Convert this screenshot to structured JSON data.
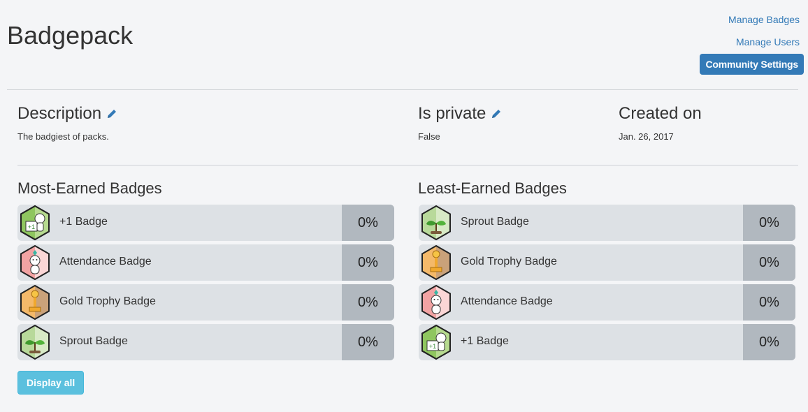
{
  "header": {
    "title": "Badgepack",
    "links": [
      "Manage Badges",
      "Manage Users"
    ],
    "settings_button": "Community Settings"
  },
  "info": {
    "description": {
      "label": "Description",
      "value": "The badgiest of packs."
    },
    "is_private": {
      "label": "Is private",
      "value": "False"
    },
    "created_on": {
      "label": "Created on",
      "value": "Jan. 26, 2017"
    }
  },
  "most_earned": {
    "title": "Most-Earned Badges",
    "items": [
      {
        "name": "+1 Badge",
        "percent": "0%",
        "icon": "plus-one-badge-icon"
      },
      {
        "name": "Attendance Badge",
        "percent": "0%",
        "icon": "attendance-badge-icon"
      },
      {
        "name": "Gold Trophy Badge",
        "percent": "0%",
        "icon": "gold-trophy-badge-icon"
      },
      {
        "name": "Sprout Badge",
        "percent": "0%",
        "icon": "sprout-badge-icon"
      }
    ]
  },
  "least_earned": {
    "title": "Least-Earned Badges",
    "items": [
      {
        "name": "Sprout Badge",
        "percent": "0%",
        "icon": "sprout-badge-icon"
      },
      {
        "name": "Gold Trophy Badge",
        "percent": "0%",
        "icon": "gold-trophy-badge-icon"
      },
      {
        "name": "Attendance Badge",
        "percent": "0%",
        "icon": "attendance-badge-icon"
      },
      {
        "name": "+1 Badge",
        "percent": "0%",
        "icon": "plus-one-badge-icon"
      }
    ]
  },
  "display_all_button": "Display all",
  "colors": {
    "link": "#337ab7",
    "primary": "#337ab7",
    "info": "#5bc0de"
  }
}
